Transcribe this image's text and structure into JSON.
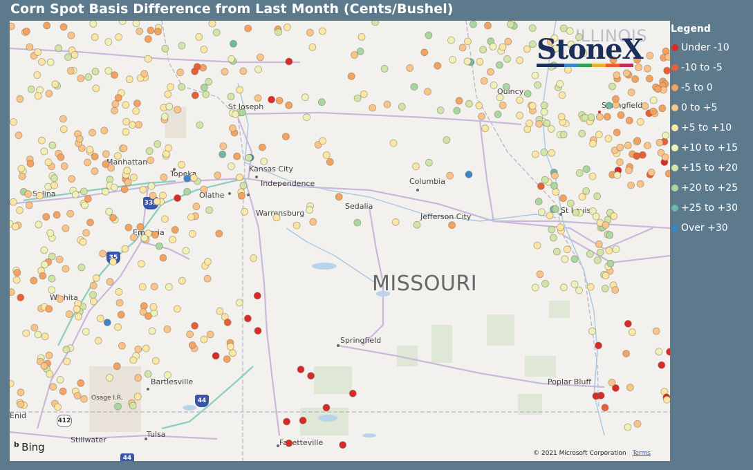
{
  "title": "Corn Spot Basis Difference from Last Month (Cents/Bushel)",
  "legend": {
    "title": "Legend",
    "items": [
      {
        "label": "Under -10",
        "color": "#d62b2b"
      },
      {
        "label": "-10 to -5",
        "color": "#e8603a"
      },
      {
        "label": "-5 to 0",
        "color": "#f4a261"
      },
      {
        "label": "0 to +5",
        "color": "#f9c48a"
      },
      {
        "label": "+5 to +10",
        "color": "#fbe7a3"
      },
      {
        "label": "+10 to +15",
        "color": "#eef2b8"
      },
      {
        "label": "+15 to +20",
        "color": "#cfe6a8"
      },
      {
        "label": "+20 to +25",
        "color": "#a8d8a0"
      },
      {
        "label": "+25 to +30",
        "color": "#6fb8a8"
      },
      {
        "label": "Over +30",
        "color": "#3a86c8"
      }
    ]
  },
  "logo": {
    "text": "StoneX"
  },
  "attribution": {
    "provider": "Bing",
    "copyright": "© 2021 Microsoft Corporation",
    "terms": "Terms"
  },
  "map_labels": {
    "state": "MISSOURI",
    "cities": [
      "St Joseph",
      "Manhattan",
      "Topeka",
      "Kansas City",
      "Independence",
      "Olathe",
      "Salina",
      "Emporia",
      "Wichita",
      "Columbia",
      "Sedalia",
      "Warrensburg",
      "Jefferson City",
      "St Louis",
      "Springfield",
      "Quincy",
      "Springfield",
      "Bartlesville",
      "Tulsa",
      "Stillwater",
      "Fayetteville",
      "Poplar Bluff",
      "Osage I.R.",
      "Enid"
    ],
    "illinois_partial": "ILLINOIS",
    "shields": [
      "335",
      "35",
      "44",
      "412",
      "44"
    ]
  }
}
